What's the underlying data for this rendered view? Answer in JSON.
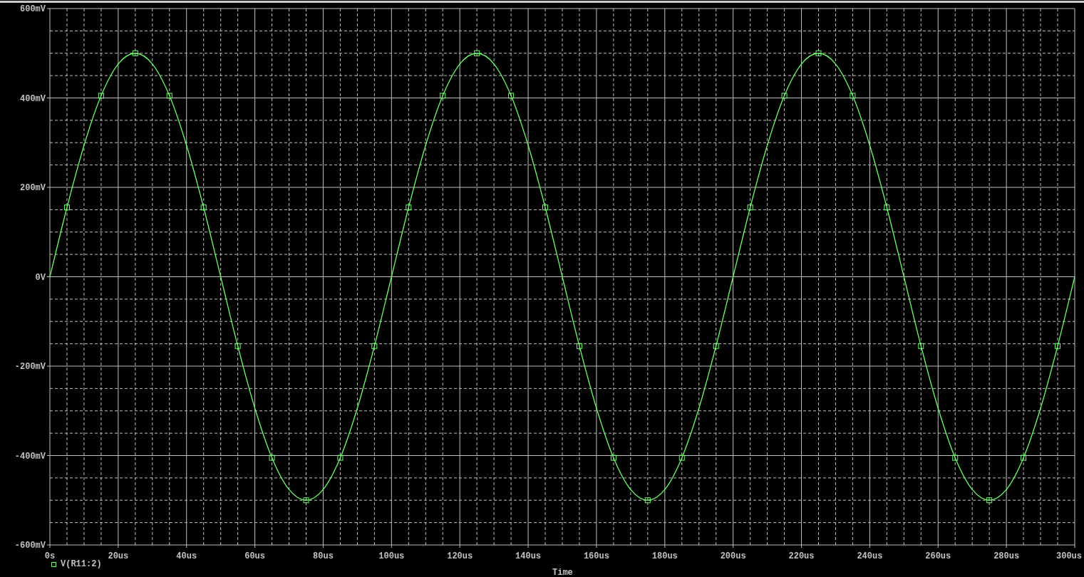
{
  "plot": {
    "chart_data": {
      "type": "line",
      "xlabel": "Time",
      "grid": true,
      "x": [
        0,
        5,
        10,
        15,
        20,
        25,
        30,
        35,
        40,
        45,
        50,
        55,
        60,
        65,
        70,
        75,
        80,
        85,
        90,
        95,
        100,
        105,
        110,
        115,
        120,
        125,
        130,
        135,
        140,
        145,
        150,
        155,
        160,
        165,
        170,
        175,
        180,
        185,
        190,
        195,
        200,
        205,
        210,
        215,
        220,
        225,
        230,
        235,
        240,
        245,
        250,
        255,
        260,
        265,
        270,
        275,
        280,
        285,
        290,
        295,
        300
      ],
      "series": [
        {
          "name": "V(R11:2)",
          "color": "#66ff66",
          "values": [
            0,
            155,
            294,
            405,
            476,
            500,
            476,
            405,
            294,
            155,
            0,
            -155,
            -294,
            -405,
            -476,
            -500,
            -476,
            -405,
            -294,
            -155,
            0,
            155,
            294,
            405,
            476,
            500,
            476,
            405,
            294,
            155,
            0,
            -155,
            -294,
            -405,
            -476,
            -500,
            -476,
            -405,
            -294,
            -155,
            0,
            155,
            294,
            405,
            476,
            500,
            476,
            405,
            294,
            155,
            0,
            -155,
            -294,
            -405,
            -476,
            -500,
            -476,
            -405,
            -294,
            -155,
            0
          ]
        }
      ],
      "xlim": [
        0,
        300
      ],
      "ylim": [
        -600,
        600
      ],
      "xticks": [
        {
          "value": 0,
          "label": "0s"
        },
        {
          "value": 20,
          "label": "20us"
        },
        {
          "value": 40,
          "label": "40us"
        },
        {
          "value": 60,
          "label": "60us"
        },
        {
          "value": 80,
          "label": "80us"
        },
        {
          "value": 100,
          "label": "100us"
        },
        {
          "value": 120,
          "label": "120us"
        },
        {
          "value": 140,
          "label": "140us"
        },
        {
          "value": 160,
          "label": "160us"
        },
        {
          "value": 180,
          "label": "180us"
        },
        {
          "value": 200,
          "label": "200us"
        },
        {
          "value": 220,
          "label": "220us"
        },
        {
          "value": 240,
          "label": "240us"
        },
        {
          "value": 260,
          "label": "260us"
        },
        {
          "value": 280,
          "label": "280us"
        },
        {
          "value": 300,
          "label": "300us"
        }
      ],
      "yticks": [
        {
          "value": 600,
          "label": "600mV"
        },
        {
          "value": 400,
          "label": "400mV"
        },
        {
          "value": 200,
          "label": "200mV"
        },
        {
          "value": 0,
          "label": "0V"
        },
        {
          "value": -200,
          "label": "-200mV"
        },
        {
          "value": -400,
          "label": "-400mV"
        },
        {
          "value": -600,
          "label": "-600mV"
        }
      ]
    }
  }
}
